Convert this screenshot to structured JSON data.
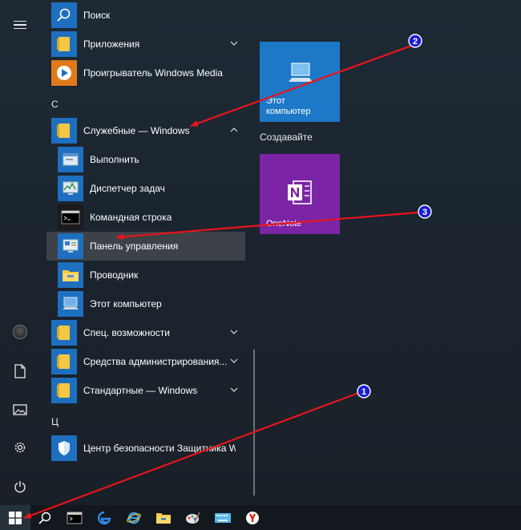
{
  "colors": {
    "accent": "#1e6fbf",
    "folder": "#f5c745",
    "onenote": "#7b24a6",
    "annotation_arrow": "#e8141c",
    "annotation_badge": "#1a1ed6"
  },
  "rail": {
    "items": [
      {
        "name": "hamburger-menu-icon"
      },
      {
        "name": "avatar"
      },
      {
        "name": "documents-icon"
      },
      {
        "name": "pictures-icon"
      },
      {
        "name": "settings-gear-icon"
      },
      {
        "name": "power-icon"
      }
    ]
  },
  "app_list": {
    "items": [
      {
        "label": "Поиск",
        "icon": "search-icon"
      },
      {
        "label": "Приложения",
        "icon": "folder-icon",
        "expandable": true
      },
      {
        "label": "Проигрыватель Windows Media",
        "icon": "media-player-icon"
      },
      {
        "letter": "С"
      },
      {
        "label": "Служебные — Windows",
        "icon": "folder-icon",
        "expanded": true
      },
      {
        "label": "Выполнить",
        "icon": "run-icon"
      },
      {
        "label": "Диспетчер задач",
        "icon": "task-manager-icon"
      },
      {
        "label": "Командная строка",
        "icon": "cmd-icon"
      },
      {
        "label": "Панель управления",
        "icon": "control-panel-icon",
        "selected": true
      },
      {
        "label": "Проводник",
        "icon": "explorer-folder-icon"
      },
      {
        "label": "Этот компьютер",
        "icon": "this-pc-icon"
      },
      {
        "label": "Спец. возможности",
        "icon": "folder-icon",
        "expandable": true
      },
      {
        "label": "Средства администрирования...",
        "icon": "folder-icon",
        "expandable": true
      },
      {
        "label": "Стандартные — Windows",
        "icon": "folder-icon",
        "expandable": true
      },
      {
        "letter": "Ц"
      },
      {
        "label": "Центр безопасности Защитника W...",
        "icon": "shield-icon"
      }
    ]
  },
  "tiles": {
    "this_pc": {
      "label_line1": "Этот",
      "label_line2": "компьютер"
    },
    "group_heading": "Создавайте",
    "onenote": {
      "label": "OneNote"
    }
  },
  "taskbar": {
    "items": [
      {
        "name": "start-windows-icon"
      },
      {
        "name": "search-icon"
      },
      {
        "name": "cmd-icon"
      },
      {
        "name": "edge-icon"
      },
      {
        "name": "internet-explorer-icon"
      },
      {
        "name": "explorer-folder-icon"
      },
      {
        "name": "paint-icon"
      },
      {
        "name": "keyboard-icon"
      },
      {
        "name": "yandex-browser-icon"
      }
    ]
  },
  "annotations": {
    "badges": [
      "1",
      "2",
      "3"
    ]
  }
}
